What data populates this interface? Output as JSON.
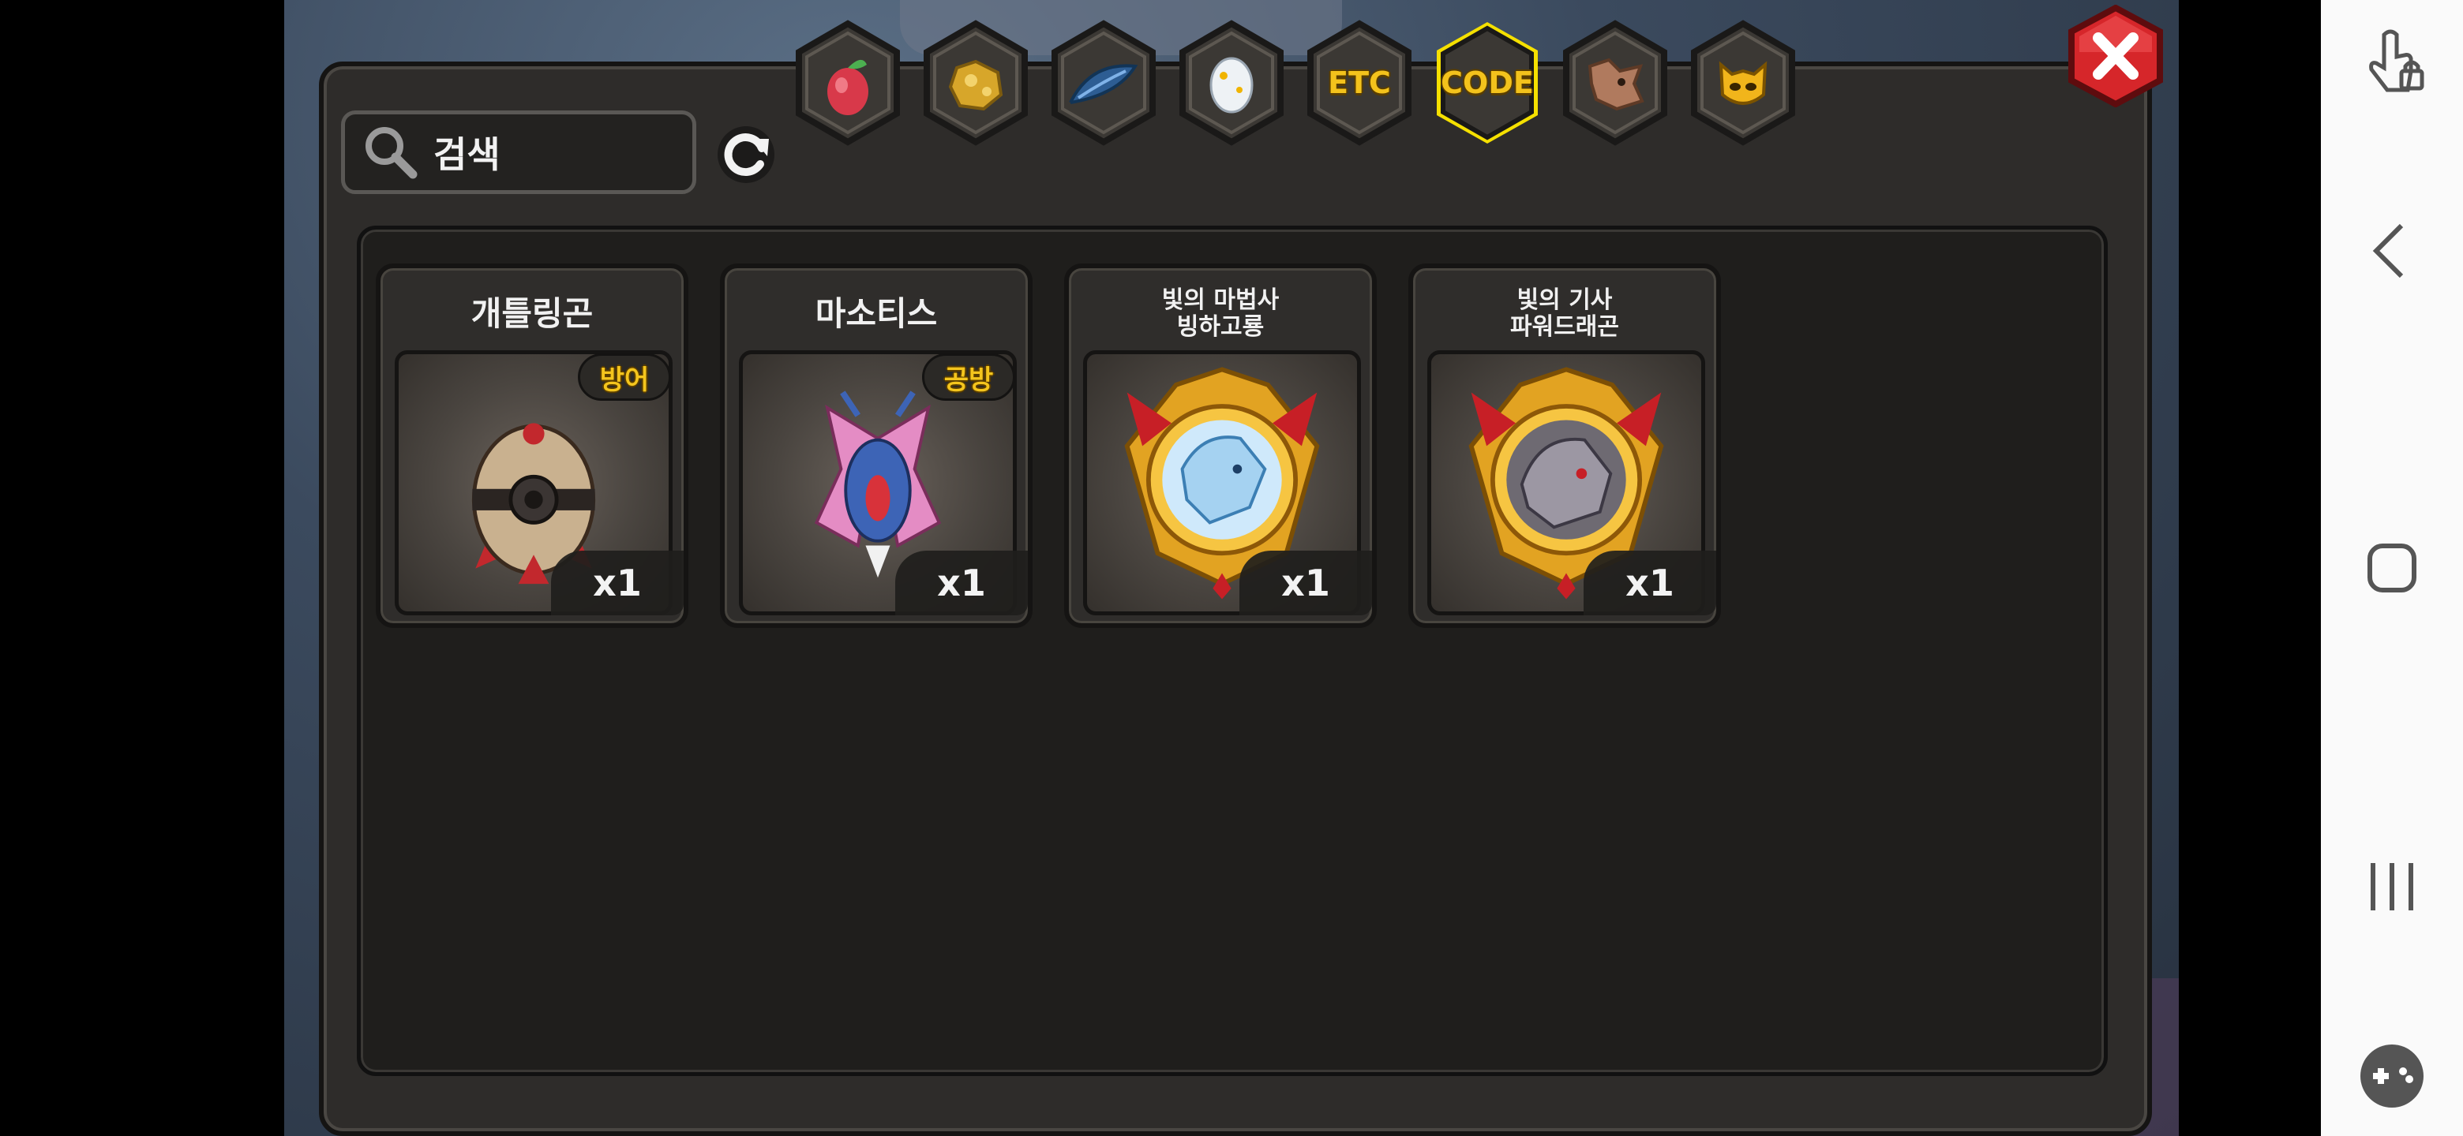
{
  "search": {
    "placeholder": "검색"
  },
  "tabs": [
    {
      "icon": "fruit-icon",
      "label": ""
    },
    {
      "icon": "gold-ore-icon",
      "label": ""
    },
    {
      "icon": "blue-feather-icon",
      "label": ""
    },
    {
      "icon": "egg-icon",
      "label": ""
    },
    {
      "icon": "etc-icon",
      "label": "ETC"
    },
    {
      "icon": "code-icon",
      "label": "CODE",
      "selected": true
    },
    {
      "icon": "dragon-head-icon",
      "label": ""
    },
    {
      "icon": "demon-mask-icon",
      "label": ""
    }
  ],
  "items": [
    {
      "name": "개틀링곤",
      "badge": "방어",
      "qty": "x1",
      "art": "gatling-egg-icon"
    },
    {
      "name": "마소티스",
      "badge": "공방",
      "qty": "x1",
      "art": "winged-bird-icon"
    },
    {
      "name": "빛의 마법사\n빙하고룡",
      "badge": "",
      "qty": "x1",
      "art": "ice-dragon-medal-icon"
    },
    {
      "name": "빛의 기사\n파워드래곤",
      "badge": "",
      "qty": "x1",
      "art": "gray-dragon-medal-icon"
    }
  ],
  "colors": {
    "tab_highlight": "#f5e000",
    "badge_text": "#f4c51d",
    "close_red": "#d6262a"
  }
}
